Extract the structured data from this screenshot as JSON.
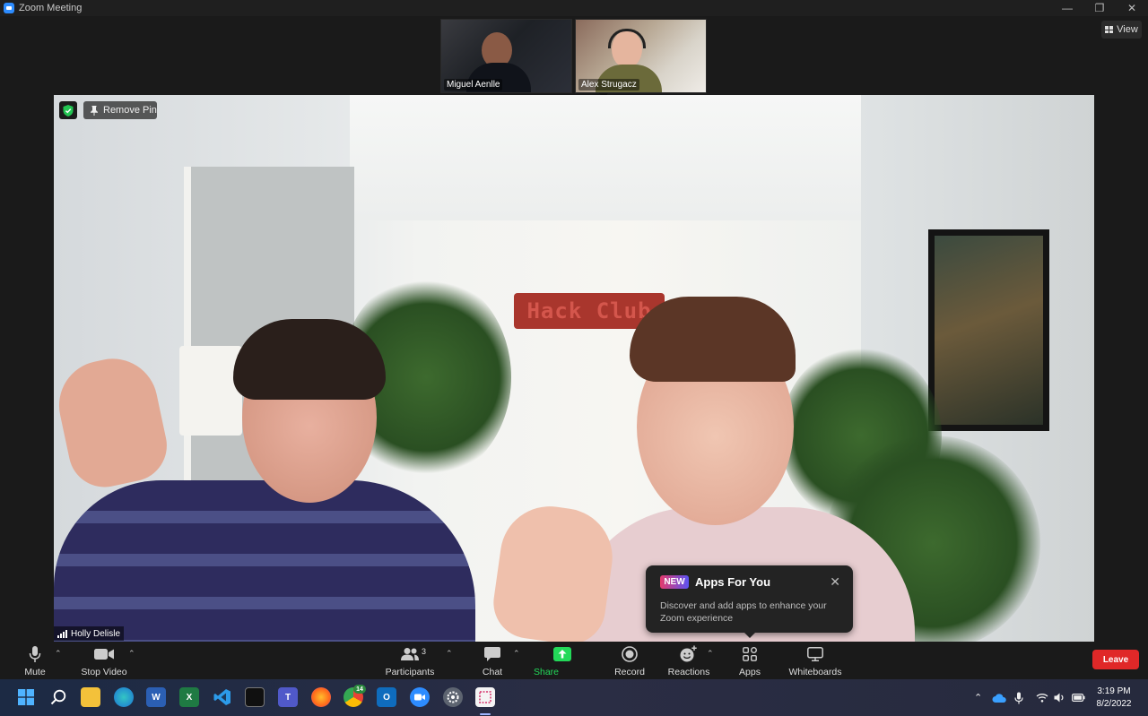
{
  "window": {
    "title": "Zoom Meeting"
  },
  "view_button": {
    "label": "View"
  },
  "thumbnails": [
    {
      "name": "Miguel Aenlle"
    },
    {
      "name": "Alex Strugacz"
    }
  ],
  "main_video": {
    "remove_pin_label": "Remove Pin",
    "speaker_name": "Holly Delisle",
    "sign_text": "Hack Club"
  },
  "popover": {
    "badge": "NEW",
    "title": "Apps For You",
    "body": "Discover and add apps to enhance your Zoom experience"
  },
  "toolbar": {
    "mute": "Mute",
    "stop_video": "Stop Video",
    "participants": "Participants",
    "participants_count": "3",
    "chat": "Chat",
    "share_screen": "Share Screen",
    "record": "Record",
    "reactions": "Reactions",
    "apps": "Apps",
    "whiteboards": "Whiteboards",
    "leave": "Leave"
  },
  "taskbar": {
    "time": "3:19 PM",
    "date": "8/2/2022",
    "chrome_badge": "14"
  },
  "colors": {
    "leave": "#e02828",
    "share_screen": "#23d959",
    "accent": "#2d8cff"
  }
}
